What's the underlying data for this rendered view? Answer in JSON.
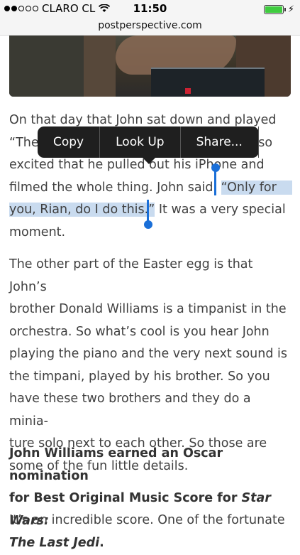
{
  "status": {
    "carrier": "CLARO CL",
    "time": "11:50",
    "signal_bars": 5,
    "signal_filled": 2,
    "battery_level": 1.0
  },
  "browser": {
    "url": "postperspective.com"
  },
  "context_menu": {
    "items": [
      "Copy",
      "Look Up",
      "Share..."
    ]
  },
  "article": {
    "p1": {
      "line1": "On that day that John sat down and played",
      "line2_start": "“The",
      "line2_end": "s so",
      "line3_before": "excited that he pulled out his iPh",
      "line3_after": "one and",
      "line4_before": "filmed the whole thing. John said, ",
      "line4_selected": "“Only for",
      "line5_selected": "you, Rian, do I do this.”",
      "line5_after": " It was a very special",
      "line6": "moment."
    },
    "p2": [
      "The other part of the Easter egg is that John’s",
      "brother Donald Williams is a timpanist in the",
      "orchestra. So what’s cool is you hear John",
      "playing the piano and the very next sound is",
      "the timpani, played by his brother. So you",
      "have these two brothers and they do a minia-",
      "ture solo next to each other. So those are",
      "some of the fun little details."
    ],
    "heading": {
      "line1": "John Williams earned an Oscar nomination",
      "line2_plain": "for Best Original Music Score for ",
      "line2_italic": "Star Wars:",
      "line3_italic": "The Last Jedi",
      "line3_end": "."
    },
    "p3_line1": "It’s an incredible score. One of the fortunate"
  }
}
